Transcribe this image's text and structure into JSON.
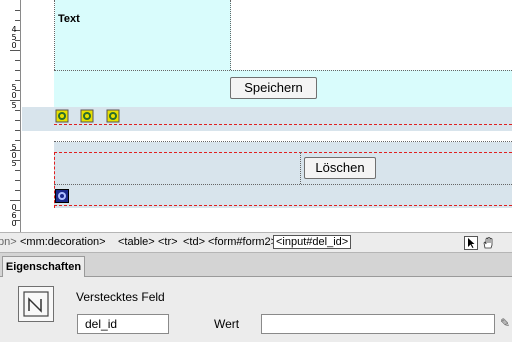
{
  "ruler": {
    "labels": [
      "4",
      "5",
      "0",
      "5",
      "0",
      "5",
      "5",
      "0",
      "5",
      "0",
      "6",
      "0"
    ]
  },
  "canvas": {
    "text_cell_label": "Text",
    "save_button": "Speichern",
    "delete_button": "Löschen"
  },
  "tag_selector": {
    "tags": [
      "pn>",
      "<mm:decoration>",
      "<table>",
      "<tr>",
      "<td>",
      "<form#form2>"
    ],
    "current_tag": "<input#del_id>"
  },
  "properties": {
    "tab_label": "Eigenschaften",
    "element_type": "Verstecktes Feld",
    "name_value": "del_id",
    "value_label": "Wert",
    "value_value": ""
  },
  "colors": {
    "accent_cyan": "#d9fcfc",
    "panel_bg": "#ececec",
    "dashed_red": "#e02020"
  }
}
